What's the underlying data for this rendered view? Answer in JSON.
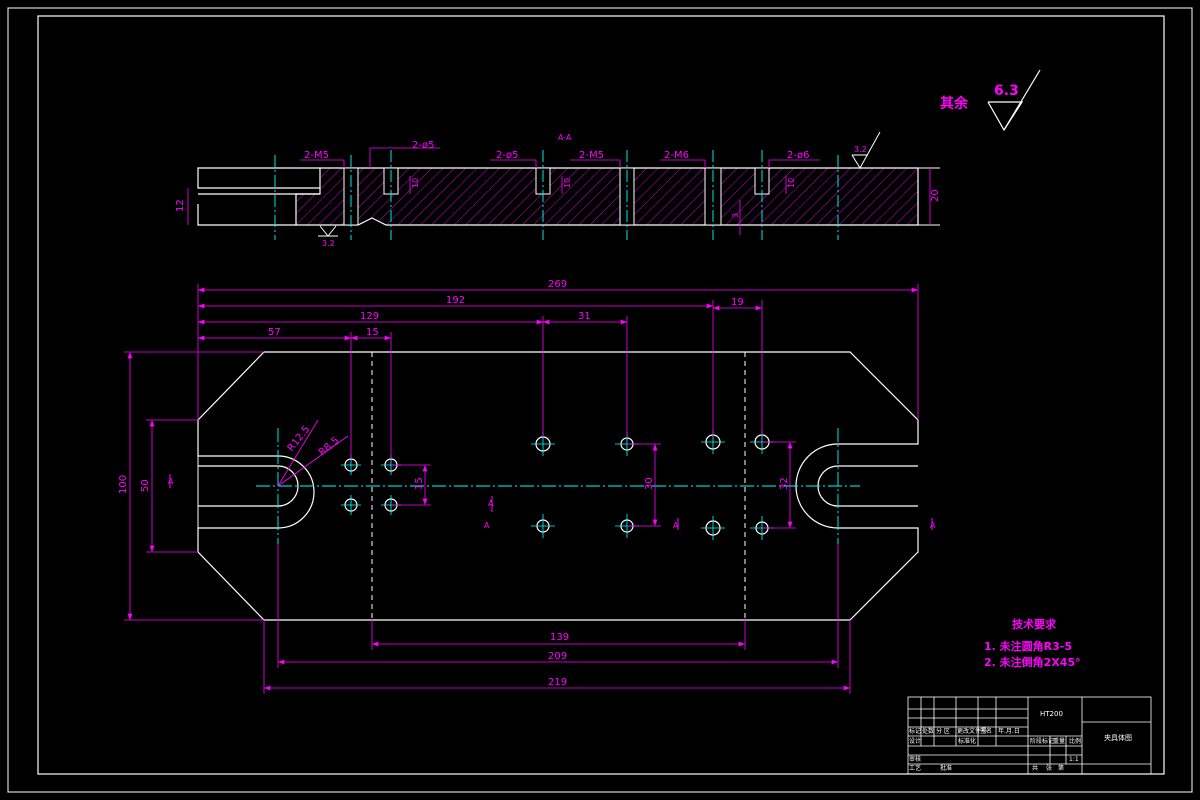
{
  "section_label": "A-A",
  "roughness": {
    "other_prefix": "其余",
    "other_value": "6.3",
    "face_top": "3.2",
    "face_bottom": "3.2"
  },
  "section_callouts": {
    "m5_left": "2-M5",
    "phi5_left": "2-ø5",
    "phi5_mid": "2-ø5",
    "m5_mid": "2-M5",
    "m6": "2-M6",
    "phi6": "2-ø6",
    "depth1": "10",
    "depth2": "10",
    "depth3": "10",
    "thickness": "20",
    "slot_height": "12",
    "step": "3"
  },
  "plan_dims": {
    "d269": "269",
    "d192": "192",
    "d129": "129",
    "d31": "31",
    "d19": "19",
    "d57": "57",
    "d15": "15",
    "d139": "139",
    "d209": "209",
    "d219": "219",
    "d100": "100",
    "d50": "50",
    "d15v": "15",
    "d30": "30",
    "d32": "32",
    "r_outer": "R12.5",
    "r_inner": "R8.5",
    "sec_mark_left": "A",
    "sec_mark_mid": "A",
    "sec_mark_midlow": "A",
    "sec_mark_c2": "A",
    "sec_mark_right": "A"
  },
  "tech_req": {
    "title": "技术要求",
    "item1": "1. 未注圆角R3-5",
    "item2": "2. 未注倒角2X45°"
  },
  "title_block": {
    "material": "HT200",
    "drawing_name": "夹具体图",
    "c_biaoji": "标记",
    "c_chushu": "处数",
    "c_fenqu": "分 区",
    "c_gengwen": "更改文件号",
    "c_qianming": "签名",
    "c_riqi": "年.月.日",
    "c_sheji": "设计",
    "c_biaozhunhua": "标准化",
    "c_jieduan": "阶段标记",
    "c_zhongliang": "重量",
    "c_bili": "比例",
    "c_scale": "1:1",
    "c_shenhe": "审核",
    "c_gongyi": "工艺",
    "c_pizhun": "批准",
    "c_gong": "共",
    "c_zhang": "张",
    "c_di": "第"
  },
  "colors": {
    "background": "#000000",
    "outline": "#ffffff",
    "dimension": "#ff00ff",
    "centerline": "#00ffff"
  }
}
